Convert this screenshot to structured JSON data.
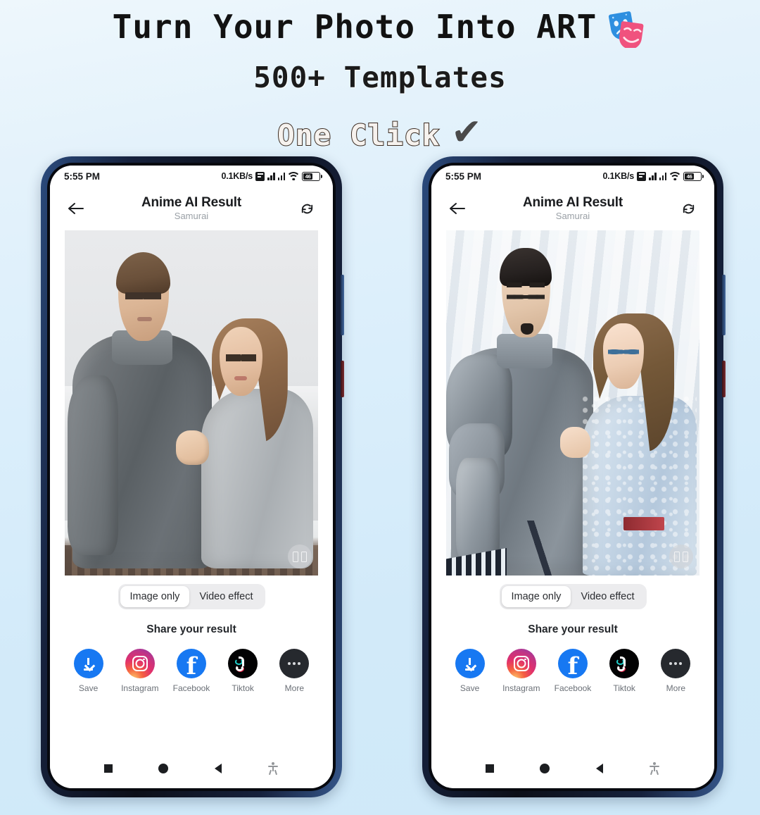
{
  "promo": {
    "line1": "Turn Your Photo Into ART",
    "line1_icon": "theater-masks-icon",
    "line2": "500+ Templates",
    "line3": "One Click",
    "line3_icon": "checkmark-icon",
    "checkmark": "✔",
    "background_color": "#d9edf8"
  },
  "phones": [
    {
      "id": "phone-before",
      "status": {
        "time": "5:55 PM",
        "net_speed": "0.1KB/s",
        "battery_level": "46",
        "icons": [
          "data-saver-icon",
          "signal-icon",
          "signal-icon",
          "wifi-icon",
          "battery-icon"
        ]
      },
      "appbar": {
        "back_icon": "back-arrow-icon",
        "title": "Anime AI Result",
        "subtitle": "Samurai",
        "refresh_icon": "refresh-icon"
      },
      "result": {
        "variant": "real",
        "compare_icon": "compare-split-icon"
      },
      "segmented": {
        "options": [
          "Image only",
          "Video effect"
        ],
        "selected": "Image only"
      },
      "share": {
        "title": "Share your result",
        "items": [
          {
            "label": "Save",
            "icon": "download-icon",
            "color": "#1778f2"
          },
          {
            "label": "Instagram",
            "icon": "instagram-icon",
            "color": "#e1306c"
          },
          {
            "label": "Facebook",
            "icon": "facebook-icon",
            "color": "#1778f2"
          },
          {
            "label": "Tiktok",
            "icon": "tiktok-icon",
            "color": "#020203"
          },
          {
            "label": "More",
            "icon": "more-dots-icon",
            "color": "#26292e"
          }
        ]
      },
      "navbar": {
        "icons": [
          "recent-apps-icon",
          "home-icon",
          "back-icon",
          "accessibility-icon"
        ]
      }
    },
    {
      "id": "phone-after",
      "status": {
        "time": "5:55 PM",
        "net_speed": "0.1KB/s",
        "battery_level": "46",
        "icons": [
          "data-saver-icon",
          "signal-icon",
          "signal-icon",
          "wifi-icon",
          "battery-icon"
        ]
      },
      "appbar": {
        "back_icon": "back-arrow-icon",
        "title": "Anime AI Result",
        "subtitle": "Samurai",
        "refresh_icon": "refresh-icon"
      },
      "result": {
        "variant": "anime",
        "compare_icon": "compare-split-icon"
      },
      "segmented": {
        "options": [
          "Image only",
          "Video effect"
        ],
        "selected": "Image only"
      },
      "share": {
        "title": "Share your result",
        "items": [
          {
            "label": "Save",
            "icon": "download-icon",
            "color": "#1778f2"
          },
          {
            "label": "Instagram",
            "icon": "instagram-icon",
            "color": "#e1306c"
          },
          {
            "label": "Facebook",
            "icon": "facebook-icon",
            "color": "#1778f2"
          },
          {
            "label": "Tiktok",
            "icon": "tiktok-icon",
            "color": "#020203"
          },
          {
            "label": "More",
            "icon": "more-dots-icon",
            "color": "#26292e"
          }
        ]
      },
      "navbar": {
        "icons": [
          "recent-apps-icon",
          "home-icon",
          "back-icon",
          "accessibility-icon"
        ]
      }
    }
  ]
}
